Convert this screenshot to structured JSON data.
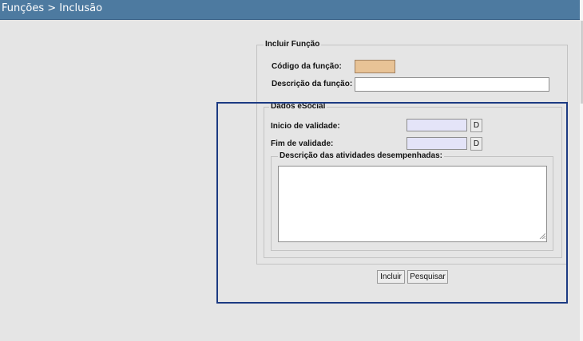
{
  "header": {
    "title": "Funções > Inclusão"
  },
  "form": {
    "legend": "Incluir Função",
    "codigo_label": "Código da função:",
    "codigo_value": "",
    "descricao_label": "Descrição da função:",
    "descricao_value": ""
  },
  "esocial": {
    "legend": "Dados eSocial",
    "inicio_label": "Inicio de validade:",
    "inicio_value": "",
    "inicio_button": "D",
    "fim_label": "Fim de validade:",
    "fim_value": "",
    "fim_button": "D",
    "atividades_legend": "Descrição das atividades desempenhadas:",
    "atividades_value": ""
  },
  "actions": {
    "incluir_label": "Incluir",
    "pesquisar_label": "Pesquisar"
  },
  "colors": {
    "header": "#4d7aa0",
    "codigo_field": "#e8c396",
    "date_field": "#e4e4f8",
    "highlight": "#1c3a82"
  }
}
